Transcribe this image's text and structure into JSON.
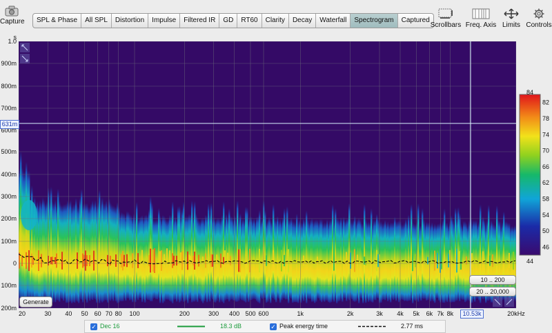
{
  "toolbar": {
    "capture_label": "Capture",
    "tabs": [
      {
        "label": "SPL & Phase"
      },
      {
        "label": "All SPL"
      },
      {
        "label": "Distortion"
      },
      {
        "label": "Impulse"
      },
      {
        "label": "Filtered IR"
      },
      {
        "label": "GD"
      },
      {
        "label": "RT60"
      },
      {
        "label": "Clarity"
      },
      {
        "label": "Decay"
      },
      {
        "label": "Waterfall"
      },
      {
        "label": "Spectrogram",
        "active": true
      },
      {
        "label": "Captured"
      }
    ],
    "right_tools": [
      {
        "label": "Scrollbars",
        "icon": "scrollbars-icon"
      },
      {
        "label": "Freq. Axis",
        "icon": "freq-axis-icon"
      },
      {
        "label": "Limits",
        "icon": "limits-icon"
      },
      {
        "label": "Controls",
        "icon": "controls-icon"
      }
    ]
  },
  "chart_data": {
    "type": "heatmap",
    "y_unit_label": "s",
    "y_tick_labels_top": [
      "1.0",
      "900m",
      "800m",
      "700m",
      "631m",
      "600m"
    ],
    "y_tick_labels_bottom": [
      "500m",
      "400m",
      "300m",
      "200m",
      "100m",
      "0",
      "100m",
      "200m"
    ],
    "x_tick_labels": [
      "20",
      "30",
      "40",
      "50",
      "60",
      "70",
      "80",
      "100",
      "200",
      "300",
      "400",
      "500",
      "600",
      "1k",
      "2k",
      "3k",
      "4k",
      "5k",
      "6k",
      "7k",
      "8k",
      "10.53k",
      "20kHz"
    ],
    "x_ticks_hz": [
      20,
      30,
      40,
      50,
      60,
      70,
      80,
      100,
      200,
      300,
      400,
      500,
      600,
      1000,
      2000,
      3000,
      4000,
      5000,
      6000,
      7000,
      8000,
      10530,
      20000
    ],
    "xlim_hz": [
      20,
      20000
    ],
    "x_scale": "log",
    "color_scale": {
      "min": 44,
      "max": 84,
      "tick_labels": [
        "84",
        "82",
        "78",
        "74",
        "70",
        "66",
        "62",
        "58",
        "54",
        "50",
        "46",
        "44"
      ]
    },
    "cursor": {
      "frequency_label": "10.53k",
      "time_label": "631m"
    },
    "peak_energy_time_ms": 2.77
  },
  "buttons": {
    "generate_label": "Generate",
    "range1_label": "10 .. 200",
    "range2_label": "20 .. 20,000"
  },
  "legend": {
    "measurement_name": "Dec 16",
    "measurement_value": "18.3 dB",
    "peak_label": "Peak energy time",
    "peak_value": "2.77 ms",
    "measurement_color": "#1a9a3a"
  }
}
